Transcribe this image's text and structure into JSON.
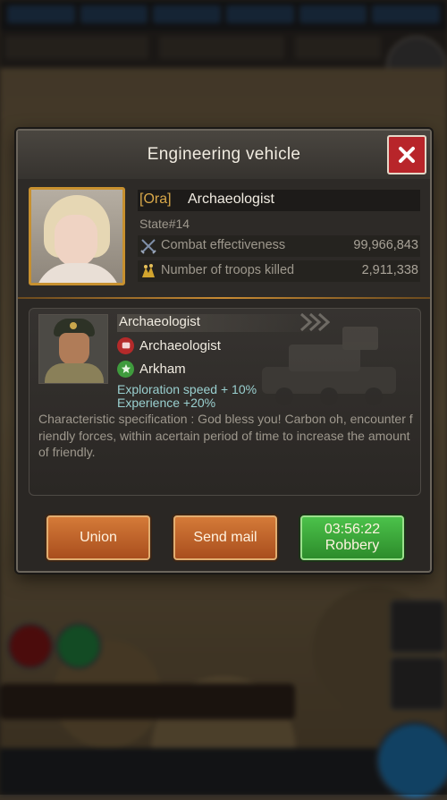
{
  "dialog": {
    "title": "Engineering vehicle",
    "close_icon": "close-icon"
  },
  "profile": {
    "tag": "[Ora]",
    "name": "Archaeologist",
    "state": "State#14",
    "stats": [
      {
        "icon": "crossed-swords-icon",
        "label": "Combat effectiveness",
        "value": "99,966,843"
      },
      {
        "icon": "troops-killed-icon",
        "label": "Number of troops killed",
        "value": "2,911,338"
      }
    ]
  },
  "vehicle_card": {
    "title": "Archaeologist",
    "role": "Archaeologist",
    "location": "Arkham",
    "bonuses": [
      "Exploration speed + 10%",
      "Experience +20%"
    ],
    "description": "Characteristic specification : God bless you! Carbon oh, encounter friendly forces, within acertain period of time to increase the amount of friendly."
  },
  "buttons": {
    "union": "Union",
    "send_mail": "Send mail",
    "robbery_timer": "03:56:22",
    "robbery": "Robbery"
  },
  "colors": {
    "accent_gold": "#c7902f",
    "close_red": "#b8252a",
    "orange_button": "#c4632a",
    "green_button": "#3aa638"
  }
}
